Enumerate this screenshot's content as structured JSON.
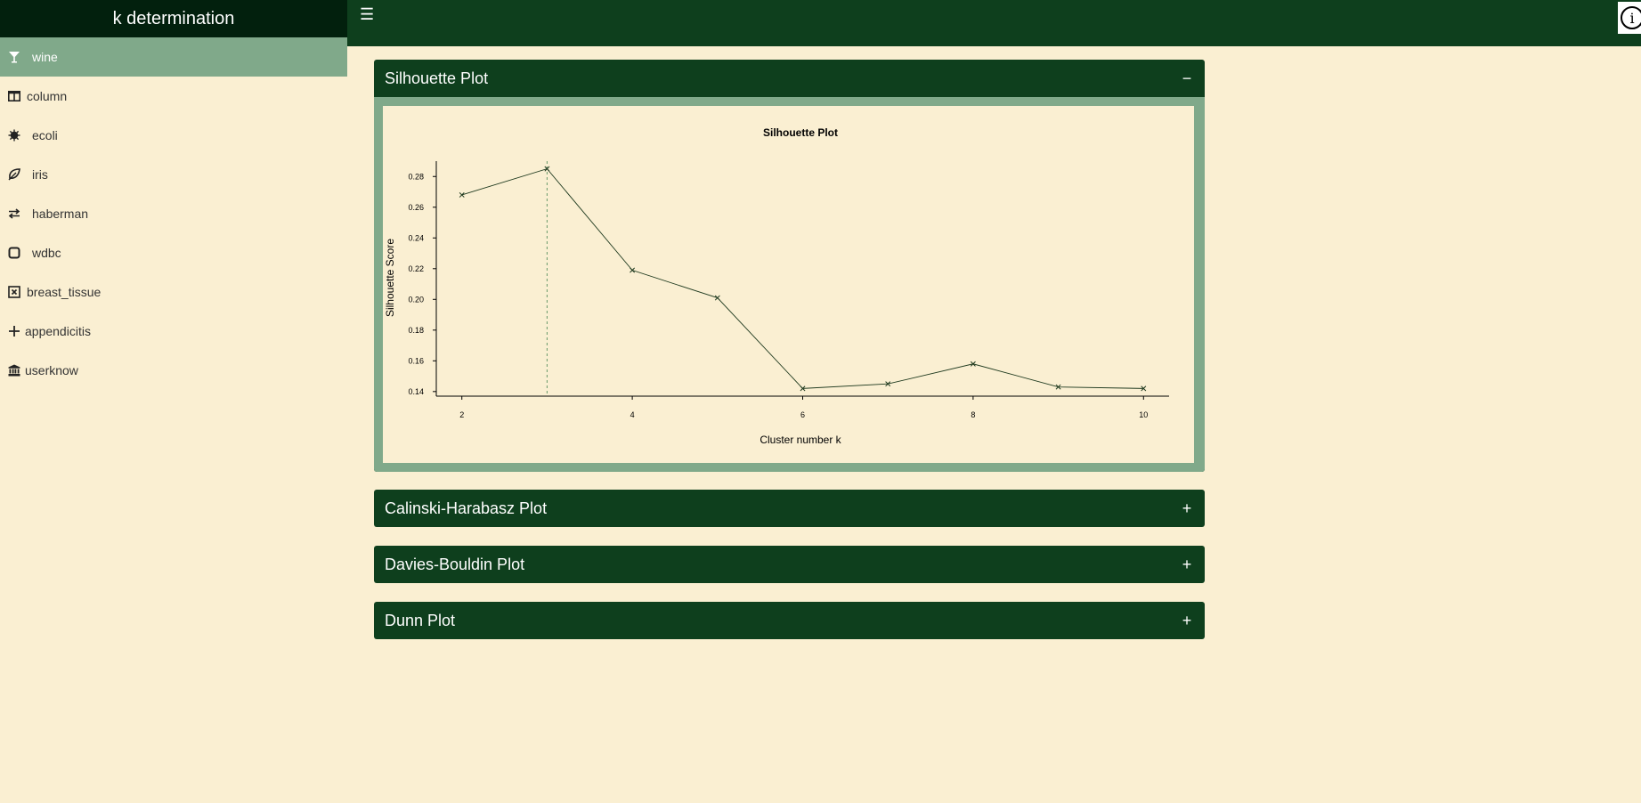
{
  "sidebar": {
    "title": "k determination",
    "items": [
      {
        "label": "wine",
        "icon": "cocktail-glass-icon",
        "active": true
      },
      {
        "label": "column",
        "icon": "columns-icon"
      },
      {
        "label": "ecoli",
        "icon": "virus-icon"
      },
      {
        "label": "iris",
        "icon": "leaf-icon"
      },
      {
        "label": "haberman",
        "icon": "exchange-icon"
      },
      {
        "label": "wdbc",
        "icon": "square-icon"
      },
      {
        "label": "breast_tissue",
        "icon": "x-square-icon"
      },
      {
        "label": "appendicitis",
        "icon": "plus-icon"
      },
      {
        "label": "userknow",
        "icon": "university-icon"
      }
    ]
  },
  "topbar": {
    "menu_icon": "hamburger-icon",
    "info_icon": "info-circle-icon",
    "info_glyph": "i"
  },
  "boxes": [
    {
      "title": "Silhouette Plot",
      "tool": "−",
      "collapsed": false
    },
    {
      "title": "Calinski-Harabasz Plot",
      "tool": "+",
      "collapsed": true
    },
    {
      "title": "Davies-Bouldin Plot",
      "tool": "+",
      "collapsed": true
    },
    {
      "title": "Dunn Plot",
      "tool": "+",
      "collapsed": true
    }
  ],
  "colors": {
    "header": "#0e3f1d",
    "brand": "#02200d",
    "accent": "#80a98a",
    "background": "#faefd2"
  },
  "chart_data": {
    "type": "line",
    "title": "Silhouette Plot",
    "xlabel": "Cluster number k",
    "ylabel": "Silhouette Score",
    "x": [
      2,
      3,
      4,
      5,
      6,
      7,
      8,
      9,
      10
    ],
    "values": [
      0.268,
      0.285,
      0.219,
      0.201,
      0.142,
      0.145,
      0.158,
      0.143,
      0.142
    ],
    "xticks": [
      2,
      4,
      6,
      8,
      10
    ],
    "yticks": [
      0.14,
      0.16,
      0.18,
      0.2,
      0.22,
      0.24,
      0.26,
      0.28
    ],
    "ytick_labels": [
      "0.14",
      "0.16",
      "0.18",
      "0.20",
      "0.22",
      "0.24",
      "0.26",
      "0.28"
    ],
    "xlim": [
      1.7,
      10.3
    ],
    "ylim": [
      0.137,
      0.29
    ],
    "optimal_k": 3,
    "marker": "x"
  }
}
